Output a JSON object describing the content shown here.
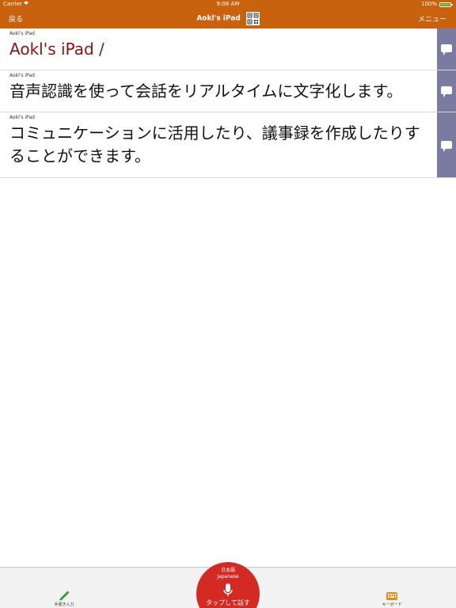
{
  "status_bar": {
    "carrier": "Carrier",
    "time": "9:08 AM",
    "battery": "100%",
    "accent": "#4cd964"
  },
  "nav": {
    "back_label": "戻る",
    "title": "Aokl's iPad",
    "menu_label": "メニュー",
    "qr_icon": "qr-code-icon",
    "bg": "#c9620f"
  },
  "messages": [
    {
      "speaker": "Aokl's iPad",
      "text": "Aokl's iPad /",
      "color": "#8b1010"
    },
    {
      "speaker": "Aokl's iPad",
      "text": "音声認識を使って会話をリアルタイムに文字化します。"
    },
    {
      "speaker": "Aokl's iPad",
      "text": "コミュニケーションに活用したり、議事録を作成したりすることができます。"
    }
  ],
  "toolbar": {
    "handwriting_label": "手書き入力",
    "talk_lang_jp": "日本語",
    "talk_lang_en": "Japanese",
    "talk_label": "タップして話す",
    "keyboard_label": "キーボード",
    "talk_color": "#d32a23"
  }
}
